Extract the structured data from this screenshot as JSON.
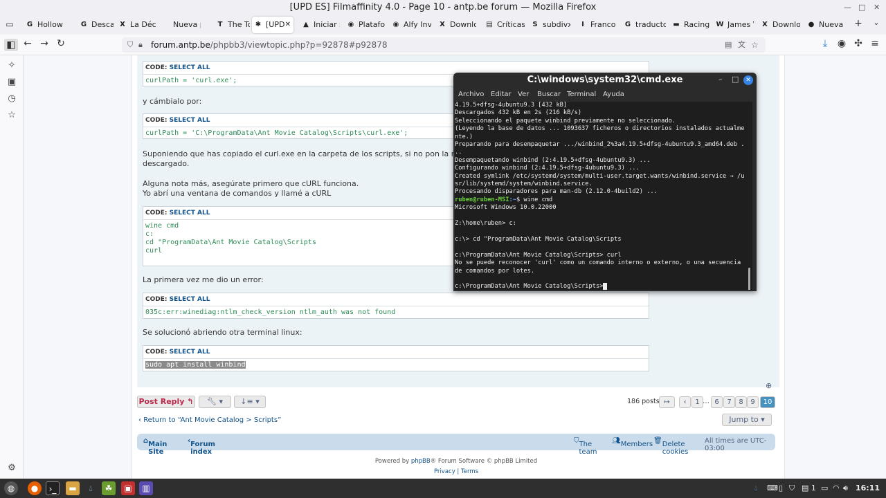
{
  "window": {
    "title": "[UPD ES] Filmaffinity 4.0 - Page 10 - antp.be forum — Mozilla Firefox"
  },
  "tabs": [
    {
      "label": "Hollow I",
      "icon": "G"
    },
    {
      "label": "Descarg",
      "icon": "G"
    },
    {
      "label": "La Décin",
      "icon": "X"
    },
    {
      "label": "Nueva pes",
      "icon": ""
    },
    {
      "label": "The Tox",
      "icon": "T"
    },
    {
      "label": "[UPD",
      "icon": "✱"
    },
    {
      "label": "Iniciar s",
      "icon": "▲"
    },
    {
      "label": "Platafor",
      "icon": "◉"
    },
    {
      "label": "Alfy Inv",
      "icon": "◉"
    },
    {
      "label": "Downlo",
      "icon": "X"
    },
    {
      "label": "Críticas",
      "icon": "▤"
    },
    {
      "label": "subdivx",
      "icon": "S"
    },
    {
      "label": "Franco",
      "icon": "I"
    },
    {
      "label": "traducto",
      "icon": "G"
    },
    {
      "label": "Racing",
      "icon": "▬"
    },
    {
      "label": "James V",
      "icon": "W"
    },
    {
      "label": "Downlo",
      "icon": "X"
    },
    {
      "label": "Nueva p",
      "icon": "●"
    }
  ],
  "url": {
    "host": "forum.antp.be",
    "path": "/phpbb3/viewtopic.php?p=92878#p92878"
  },
  "post": {
    "code_header": "CODE:",
    "select_all": "SELECT ALL",
    "code1": "curlPath = 'curl.exe';",
    "text1": "y cámbialo por:",
    "code2": "curlPath = 'C:\\ProgramData\\Ant Movie Catalog\\Scripts\\curl.exe';",
    "text2a": "Suponiendo que has copiado el curl.exe en la carpeta de los scripts, si no pon la ruta completa a d",
    "text2b": "descargado.",
    "text3a": "Alguna nota más, asegúrate primero que cURL funciona.",
    "text3b": "Yo abrí una ventana de comandos y llamé a cURL",
    "code3": "wine cmd\nc:\ncd \"ProgramData\\Ant Movie Catalog\\Scripts\ncurl",
    "text4": "La primera vez me dio un error:",
    "code4": "035c:err:winediag:ntlm_check_version ntlm_auth was not found",
    "text5": "Se solucionó abriendo otra terminal linux:",
    "code5": "sudo apt install winbind"
  },
  "terminal": {
    "title": "C:\\windows\\system32\\cmd.exe",
    "menu": [
      "Archivo",
      "Editar",
      "Ver",
      "Buscar",
      "Terminal",
      "Ayuda"
    ],
    "lines_before": "4.19.5+dfsg-4ubuntu9.3 [432 kB]\nDescargados 432 kB en 2s (216 kB/s)\nSeleccionando el paquete winbind previamente no seleccionado.\n(Leyendo la base de datos ... 1093637 ficheros o directorios instalados actualme\nnte.)\nPreparando para desempaquetar .../winbind_2%3a4.19.5+dfsg-4ubuntu9.3_amd64.deb .\n..\nDesempaquetando winbind (2:4.19.5+dfsg-4ubuntu9.3) ...\nConfigurando winbind (2:4.19.5+dfsg-4ubuntu9.3) ...\nCreated symlink /etc/systemd/system/multi-user.target.wants/winbind.service → /u\nsr/lib/systemd/system/winbind.service.\nProcesando disparadores para man-db (2.12.0-4build2) ...",
    "prompt_user": "ruben@ruben-MSI",
    "prompt_path": ":~",
    "prompt_cmd": "$ wine cmd",
    "lines_after": "Microsoft Windows 10.0.22000\n\nZ:\\home\\ruben> c:\n\nc:\\> cd \"ProgramData\\Ant Movie Catalog\\Scripts\n\nc:\\ProgramData\\Ant Movie Catalog\\Scripts> curl\nNo se puede reconocer 'curl' como un comando interno o externo, o una secuencia\nde comandos por lotes.\n\nc:\\ProgramData\\Ant Movie Catalog\\Scripts>"
  },
  "footer": {
    "post_reply": "Post Reply",
    "posts_count": "186 posts",
    "pages": [
      "1",
      "…",
      "6",
      "7",
      "8",
      "9",
      "10"
    ],
    "return_link": "Return to “Ant Movie Catalog > Scripts”",
    "jump_to": "Jump to",
    "main_site": "Main Site",
    "forum_index": "Forum index",
    "the_team": "The team",
    "members": "Members",
    "delete_cookies": "Delete cookies",
    "timezone": "All times are UTC-03:00",
    "powered_by_pre": "Powered by ",
    "phpbb": "phpBB",
    "powered_by_post": "® Forum Software © phpBB Limited",
    "privacy": "Privacy",
    "terms": "Terms"
  },
  "taskbar": {
    "clock": "16:11",
    "workspace": "1"
  },
  "colors": {
    "accent": "#105289",
    "code_green": "#2e8b57",
    "post_reply": "#bc2a4d",
    "active_page": "#4692bf"
  }
}
